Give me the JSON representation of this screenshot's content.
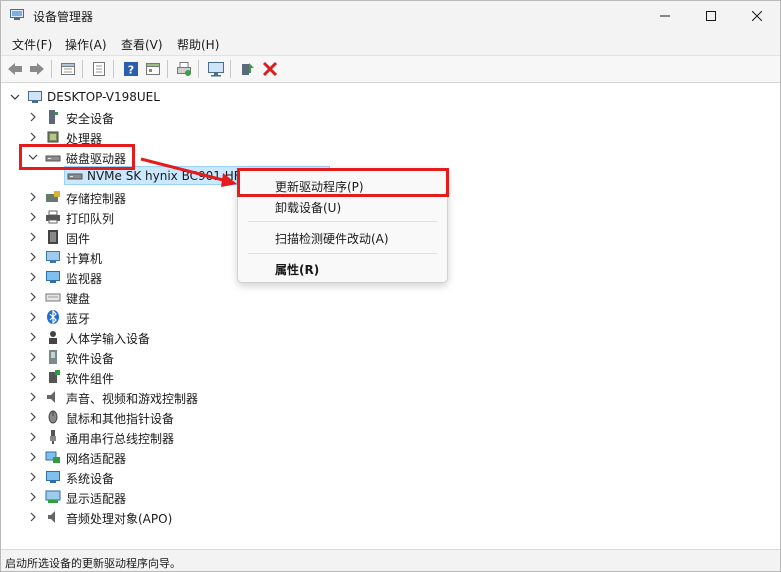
{
  "window": {
    "title": "设备管理器",
    "controls": [
      "minimize",
      "maximize",
      "close"
    ]
  },
  "menu": [
    "文件(F)",
    "操作(A)",
    "查看(V)",
    "帮助(H)"
  ],
  "toolbar": {
    "icons": [
      "back-icon",
      "forward-icon",
      "properties-icon",
      "list-icon",
      "help-icon",
      "view-icon",
      "print-icon",
      "monitor-icon",
      "update-driver-icon",
      "uninstall-icon"
    ]
  },
  "tree": {
    "root": "DESKTOP-V198UEL",
    "categories": [
      {
        "label": "安全设备",
        "icon": "security-device-icon",
        "expanded": false
      },
      {
        "label": "处理器",
        "icon": "processor-icon",
        "expanded": false
      },
      {
        "label": "磁盘驱动器",
        "icon": "disk-drive-icon",
        "expanded": true
      },
      {
        "label": "存储控制器",
        "icon": "storage-controller-icon",
        "expanded": false
      },
      {
        "label": "打印队列",
        "icon": "printer-icon",
        "expanded": false
      },
      {
        "label": "固件",
        "icon": "firmware-icon",
        "expanded": false
      },
      {
        "label": "计算机",
        "icon": "computer-icon",
        "expanded": false
      },
      {
        "label": "监视器",
        "icon": "monitor-icon",
        "expanded": false
      },
      {
        "label": "键盘",
        "icon": "keyboard-icon",
        "expanded": false
      },
      {
        "label": "蓝牙",
        "icon": "bluetooth-icon",
        "expanded": false
      },
      {
        "label": "人体学输入设备",
        "icon": "hid-icon",
        "expanded": false
      },
      {
        "label": "软件设备",
        "icon": "software-device-icon",
        "expanded": false
      },
      {
        "label": "软件组件",
        "icon": "software-component-icon",
        "expanded": false
      },
      {
        "label": "声音、视频和游戏控制器",
        "icon": "sound-icon",
        "expanded": false
      },
      {
        "label": "鼠标和其他指针设备",
        "icon": "mouse-icon",
        "expanded": false
      },
      {
        "label": "通用串行总线控制器",
        "icon": "usb-icon",
        "expanded": false
      },
      {
        "label": "网络适配器",
        "icon": "network-adapter-icon",
        "expanded": false
      },
      {
        "label": "系统设备",
        "icon": "system-device-icon",
        "expanded": false
      },
      {
        "label": "显示适配器",
        "icon": "display-adapter-icon",
        "expanded": false
      },
      {
        "label": "音频处理对象(APO)",
        "icon": "audio-processing-icon",
        "expanded": false
      }
    ],
    "disk_child": "NVMe SK hynix BC901 HFS"
  },
  "context_menu": {
    "items": [
      {
        "label": "更新驱动程序(P)",
        "bold": false
      },
      {
        "label": "卸载设备(U)",
        "bold": false
      },
      {
        "label": "扫描检测硬件改动(A)",
        "bold": false
      },
      {
        "label": "属性(R)",
        "bold": true
      }
    ]
  },
  "status": "启动所选设备的更新驱动程序向导。",
  "colors": {
    "highlight_red": "#e41c1c",
    "selection_bg": "#cce8ff",
    "selection_border": "#99d1ff"
  }
}
